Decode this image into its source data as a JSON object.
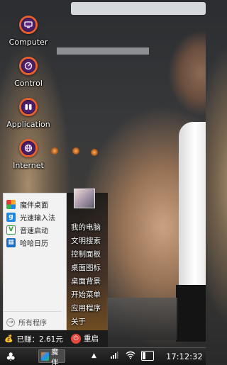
{
  "desktop": {
    "icons": [
      {
        "label": "Computer",
        "icon": "monitor-icon"
      },
      {
        "label": "Control",
        "icon": "gauge-icon"
      },
      {
        "label": "Application",
        "icon": "apps-icon"
      },
      {
        "label": "Internet",
        "icon": "globe-icon"
      }
    ]
  },
  "start_menu": {
    "apps": [
      {
        "label": "魔伴桌面",
        "icon": "pinwheel-icon",
        "color": "#f5a623"
      },
      {
        "label": "光速输入法",
        "icon": "input-g-icon",
        "color": "#1e88e5"
      },
      {
        "label": "音速启动",
        "icon": "v-launch-icon",
        "color": "#2e9e3a"
      },
      {
        "label": "哈哈日历",
        "icon": "calendar-icon",
        "color": "#1d6fc4"
      }
    ],
    "all_programs": "所有程序",
    "right_items": [
      "我的电脑",
      "文明搜索",
      "控制面板",
      "桌面图标",
      "桌面背景",
      "开始菜单",
      "应用程序",
      "关于"
    ],
    "earned": "已赚：2.61元",
    "shutdown": "重启"
  },
  "taskbar": {
    "start_icon": "clover-icon",
    "task_label": "魔伴",
    "tray_arrow": "▲",
    "battery_level": 0.3,
    "time": "17:12:32"
  }
}
